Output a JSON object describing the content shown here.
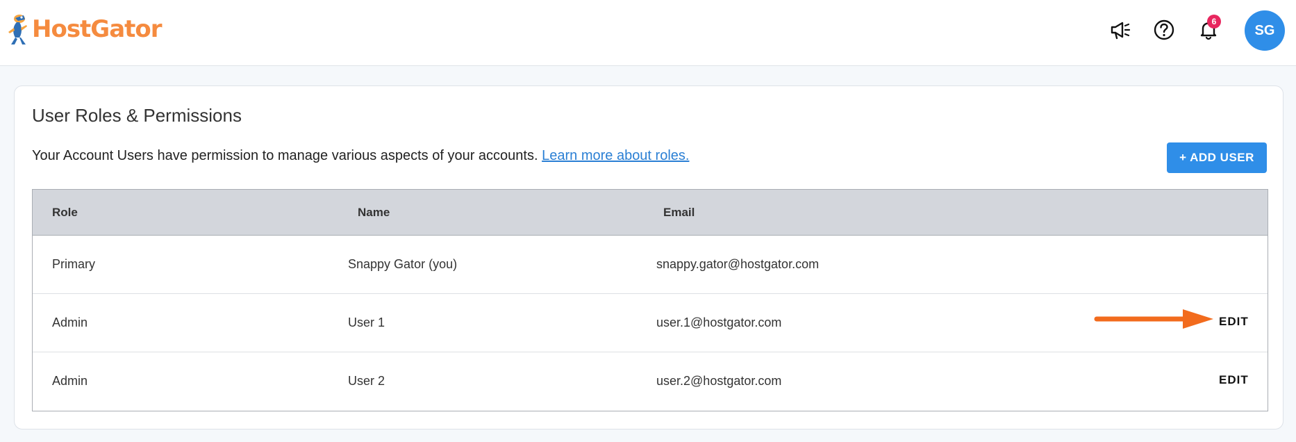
{
  "header": {
    "brand": "HostGator",
    "notification_count": "6",
    "avatar_initials": "SG",
    "icons": [
      "megaphone-icon",
      "help-icon",
      "bell-icon"
    ],
    "brand_color": "#f58b3f",
    "accent_color": "#2f8ee8"
  },
  "main": {
    "title": "User Roles & Permissions",
    "description": "Your Account Users have permission to manage various aspects of your accounts.",
    "learn_more": "Learn more about roles.",
    "add_user_label": "+ ADD USER"
  },
  "table": {
    "columns": [
      "Role",
      "Name",
      "Email"
    ],
    "rows": [
      {
        "role": "Primary",
        "name": "Snappy Gator (you)",
        "email": "snappy.gator@hostgator.com",
        "action": ""
      },
      {
        "role": "Admin",
        "name": "User 1",
        "email": "user.1@hostgator.com",
        "action": "EDIT"
      },
      {
        "role": "Admin",
        "name": "User 2",
        "email": "user.2@hostgator.com",
        "action": "EDIT"
      }
    ]
  }
}
